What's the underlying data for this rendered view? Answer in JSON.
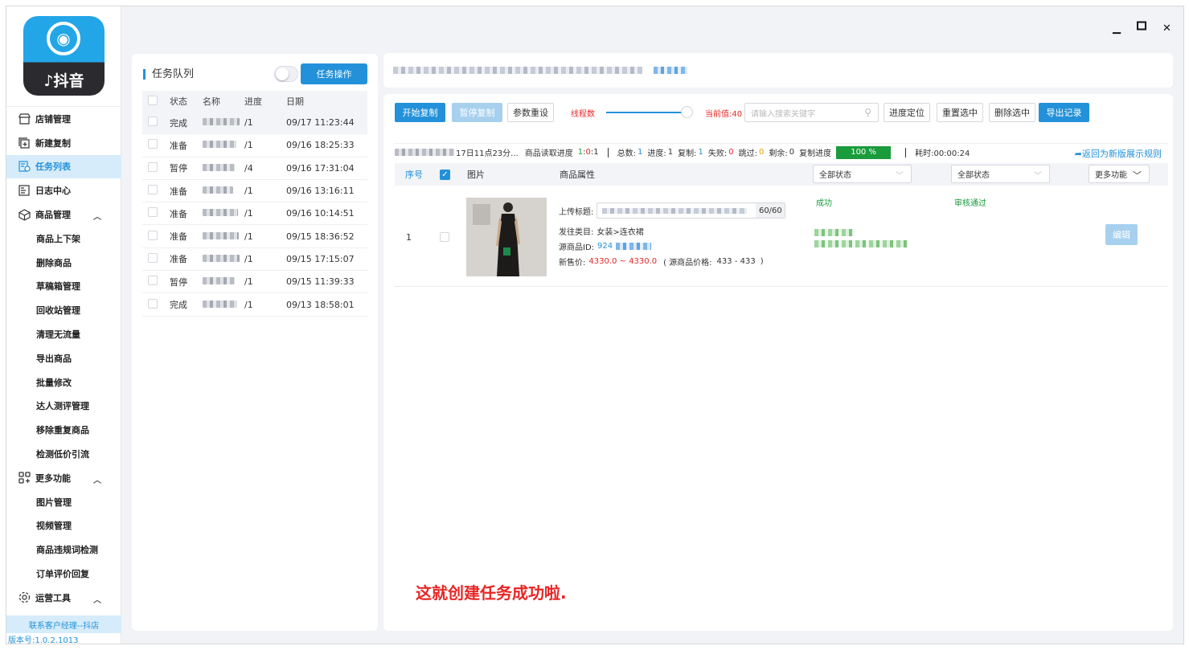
{
  "window": {
    "min_icon": "minimize-icon",
    "max_icon": "maximize-icon",
    "close_icon": "close-icon"
  },
  "sidebar": {
    "logo_symbol": "◉",
    "logo_text": "♪抖音",
    "items": [
      {
        "label": "店铺管理",
        "icon": "store-icon"
      },
      {
        "label": "新建复制",
        "icon": "add-copy-icon"
      },
      {
        "label": "任务列表",
        "icon": "task-list-icon",
        "active": true
      },
      {
        "label": "日志中心",
        "icon": "log-icon"
      },
      {
        "label": "商品管理",
        "icon": "cube-icon",
        "expanded": true
      },
      {
        "label": "商品上下架"
      },
      {
        "label": "删除商品"
      },
      {
        "label": "草稿箱管理"
      },
      {
        "label": "回收站管理"
      },
      {
        "label": "清理无流量"
      },
      {
        "label": "导出商品"
      },
      {
        "label": "批量修改"
      },
      {
        "label": "达人测评管理"
      },
      {
        "label": "移除重复商品"
      },
      {
        "label": "检测低价引流"
      },
      {
        "label": "更多功能",
        "icon": "grid-icon",
        "expanded": true
      },
      {
        "label": "图片管理"
      },
      {
        "label": "视频管理"
      },
      {
        "label": "商品违规词检测"
      },
      {
        "label": "订单评价回复"
      },
      {
        "label": "运营工具",
        "icon": "tools-icon",
        "expanded": true
      }
    ],
    "contact": "联系客户经理--抖店",
    "version": "版本号:1.0.2.1013"
  },
  "queue": {
    "title": "任务队列",
    "action_button": "任务操作",
    "columns": [
      "状态",
      "名称",
      "进度",
      "日期"
    ],
    "rows": [
      {
        "status": "完成",
        "progress": "/1",
        "date": "09/17 11:23:44"
      },
      {
        "status": "准备",
        "progress": "/1",
        "date": "09/16 18:25:33"
      },
      {
        "status": "暂停",
        "progress": "/4",
        "date": "09/16 17:31:04"
      },
      {
        "status": "准备",
        "progress": "/1",
        "date": "09/16 13:16:11"
      },
      {
        "status": "准备",
        "progress": "/1",
        "date": "09/16 10:14:51"
      },
      {
        "status": "准备",
        "progress": "/1",
        "date": "09/15 18:36:52"
      },
      {
        "status": "准备",
        "progress": "/1",
        "date": "09/15 17:15:07"
      },
      {
        "status": "暂停",
        "progress": "/1",
        "date": "09/15 11:39:33"
      },
      {
        "status": "完成",
        "progress": "/1",
        "date": "09/13 18:58:01"
      }
    ]
  },
  "toolbar": {
    "start": "开始复制",
    "pause": "暂停复制",
    "reset_params": "参数重设",
    "threads_label": "线程数",
    "current_value": "当前值:40",
    "search_placeholder": "请输入搜索关键字",
    "locate": "进度定位",
    "reset_selected": "重置选中",
    "delete_selected": "删除选中",
    "export": "导出记录"
  },
  "stats": {
    "time_suffix": "17日11点23分...",
    "read_label": "商品读取进度",
    "read_a": "1",
    "read_colon1": ":",
    "read_b": "0",
    "read_colon2": ":",
    "read_c": "1",
    "total_label": "总数:",
    "total": "1",
    "progress_label": "进度:",
    "progress": "1",
    "copied_label": "复制:",
    "copied": "1",
    "failed_label": "失败:",
    "failed": "0",
    "skipped_label": "跳过:",
    "skipped": "0",
    "remaining_label": "剩余:",
    "remaining": "0",
    "copy_progress_label": "复制进度",
    "copy_progress": "100 %",
    "elapsed": "耗时:00:00:24",
    "return_link": "➦返回为新版展示规则"
  },
  "table": {
    "col_index": "序号",
    "col_image": "图片",
    "col_attr": "商品属性",
    "status_filter_1": "全部状态",
    "status_filter_2": "全部状态",
    "more": "更多功能"
  },
  "product": {
    "index": "1",
    "upload_title_label": "上传标题:",
    "title_count": "60/60",
    "category_label": "发往类目:",
    "category": "女装>连衣裙",
    "source_id_label": "源商品ID:",
    "source_id": "924",
    "price_label": "新售价:",
    "price": "4330.0 ~ 4330.0",
    "source_price_open": "( 源商品价格:",
    "source_price": "433 - 433",
    "source_price_close": ")",
    "status": "成功",
    "review": "审核通过",
    "edit": "编辑"
  },
  "message": "这就创建任务成功啦.",
  "colors": {
    "accent": "#2391d9",
    "success": "#1a9b3c",
    "danger": "#e82626"
  }
}
